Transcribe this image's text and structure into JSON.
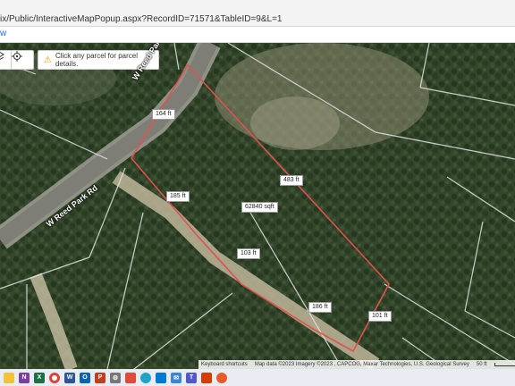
{
  "browser": {
    "url_prefix": "ix/Public/InteractiveMapPopup.aspx?RecordID=71571&TableID=9&L=1",
    "tab_fragment": "w"
  },
  "map": {
    "tip_icon": "warning-icon",
    "tip_text": "Click any parcel for parcel details.",
    "roads": {
      "road_upper": "W Reed Park Rd",
      "road_lower": "W Reed Park Rd"
    },
    "parcel": {
      "area": "62840 sqft",
      "edge_top": "164 ft",
      "edge_left": "185 ft",
      "edge_right_long": "483 ft",
      "edge_bottom_mid": "103 ft",
      "edge_bottom_right": "186 ft",
      "edge_corner": "101 ft"
    },
    "attribution": {
      "shortcuts": "Keyboard shortcuts",
      "data": "Map data ©2023 Imagery ©2023 , CAPCOG, Maxar Technologies, U.S. Geological Survey",
      "scale": "50 ft"
    },
    "colors": {
      "parcel_outline": "#e0524e",
      "lot_lines": "#e8e8e8"
    }
  },
  "taskbar": {
    "icons": [
      "file-explorer-icon",
      "onenote-icon",
      "excel-icon",
      "chrome-icon",
      "word-icon",
      "outlook-icon",
      "powerpoint-icon",
      "settings-icon",
      "photos-icon",
      "edge-icon",
      "store-icon",
      "mail-icon",
      "teams-icon",
      "acrobat-icon",
      "app-icon"
    ]
  }
}
